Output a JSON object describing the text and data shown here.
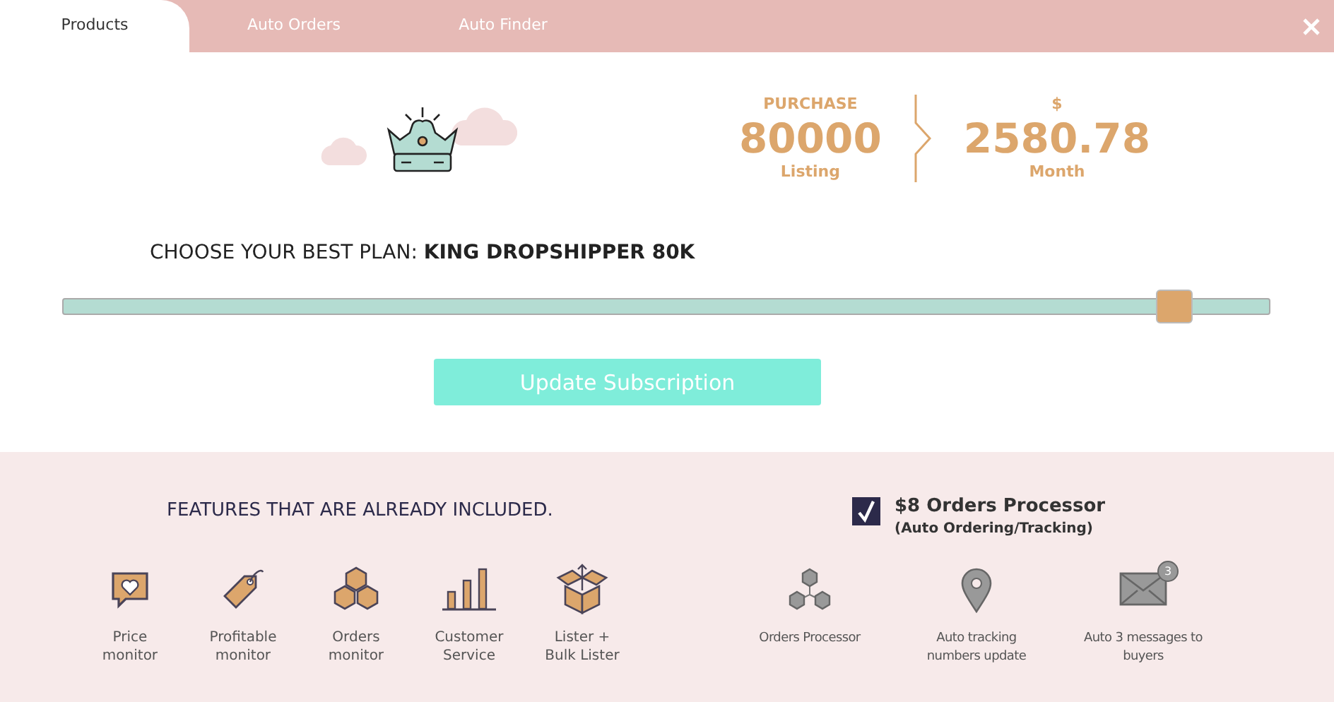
{
  "tabs": [
    {
      "label": "Products",
      "selected": true
    },
    {
      "label": "Auto Orders",
      "selected": false
    },
    {
      "label": "Auto Finder",
      "selected": false
    }
  ],
  "stats": [
    {
      "caption": "PURCHASE",
      "value": "80000",
      "unit": "Listing"
    },
    {
      "caption": "$",
      "value": "2580.78",
      "unit": "Month"
    }
  ],
  "plan": {
    "heading": "CHOOSE YOUR BEST PLAN: **KING DROPSHIPPER 80K**",
    "level": 0.92
  },
  "update_button": "Update Subscription",
  "included": {
    "title": "FEATURES THAT ARE ALREADY INCLUDED.",
    "features": [
      {
        "kind": "heart",
        "label": "Price monitor"
      },
      {
        "kind": "tag",
        "label": "Profitable monitor"
      },
      {
        "kind": "boxes",
        "label": "Orders monitor"
      },
      {
        "kind": "bars",
        "label": "Customer Service"
      },
      {
        "kind": "box",
        "label": "Lister + Bulk Lister"
      }
    ]
  },
  "addon": {
    "checked": true,
    "title": "$8 Orders Processor",
    "subtitle": "(Auto Ordering/Tracking)",
    "features": [
      {
        "kind": "network",
        "label": "Orders Processor"
      },
      {
        "kind": "pin",
        "label": "Auto tracking numbers update"
      },
      {
        "kind": "mail",
        "label": "Auto 3 messages to buyers",
        "badge": "3"
      }
    ]
  }
}
